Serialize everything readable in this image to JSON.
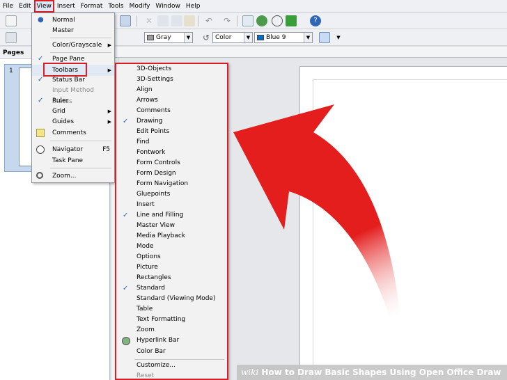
{
  "menubar": {
    "items": [
      "File",
      "Edit",
      "View",
      "Insert",
      "Format",
      "Tools",
      "Modify",
      "Window",
      "Help"
    ]
  },
  "toolbar2": {
    "area_style_value": "Gray",
    "line_style_value": "Color",
    "line_color_value": "Blue 9",
    "line_color_hex": "#0a6ac8"
  },
  "pages_pane": {
    "title": "Pages",
    "page_number": "1"
  },
  "view_menu": {
    "items": [
      {
        "label": "Normal",
        "mark": "radio"
      },
      {
        "label": "Master",
        "mark": ""
      },
      {
        "label": "Color/Grayscale",
        "mark": "",
        "submenu": true
      },
      {
        "label": "Page Pane",
        "mark": "check"
      },
      {
        "label": "Toolbars",
        "mark": "",
        "submenu": true
      },
      {
        "label": "Status Bar",
        "mark": "check"
      },
      {
        "label": "Input Method Status",
        "mark": "",
        "disabled": true
      },
      {
        "label": "Ruler",
        "mark": "check"
      },
      {
        "label": "Grid",
        "mark": "",
        "submenu": true
      },
      {
        "label": "Guides",
        "mark": "",
        "submenu": true
      },
      {
        "label": "Comments",
        "mark": "icon"
      },
      {
        "label": "Navigator",
        "mark": "icon",
        "shortcut": "F5"
      },
      {
        "label": "Task Pane",
        "mark": ""
      },
      {
        "label": "Zoom...",
        "mark": "icon"
      }
    ]
  },
  "toolbars_submenu": {
    "items": [
      {
        "label": "3D-Objects",
        "checked": false
      },
      {
        "label": "3D-Settings",
        "checked": false
      },
      {
        "label": "Align",
        "checked": false
      },
      {
        "label": "Arrows",
        "checked": false
      },
      {
        "label": "Comments",
        "checked": false
      },
      {
        "label": "Drawing",
        "checked": true
      },
      {
        "label": "Edit Points",
        "checked": false
      },
      {
        "label": "Find",
        "checked": false
      },
      {
        "label": "Fontwork",
        "checked": false
      },
      {
        "label": "Form Controls",
        "checked": false
      },
      {
        "label": "Form Design",
        "checked": false
      },
      {
        "label": "Form Navigation",
        "checked": false
      },
      {
        "label": "Gluepoints",
        "checked": false
      },
      {
        "label": "Insert",
        "checked": false
      },
      {
        "label": "Line and Filling",
        "checked": true
      },
      {
        "label": "Master View",
        "checked": false
      },
      {
        "label": "Media Playback",
        "checked": false
      },
      {
        "label": "Mode",
        "checked": false
      },
      {
        "label": "Options",
        "checked": false
      },
      {
        "label": "Picture",
        "checked": false
      },
      {
        "label": "Rectangles",
        "checked": false
      },
      {
        "label": "Standard",
        "checked": true
      },
      {
        "label": "Standard (Viewing Mode)",
        "checked": false
      },
      {
        "label": "Table",
        "checked": false
      },
      {
        "label": "Text Formatting",
        "checked": false
      },
      {
        "label": "Zoom",
        "checked": false
      },
      {
        "label": "Hyperlink Bar",
        "checked": false,
        "icon": true
      },
      {
        "label": "Color Bar",
        "checked": false
      },
      {
        "label": "Customize...",
        "checked": false
      },
      {
        "label": "Reset",
        "checked": false,
        "disabled": true
      }
    ]
  },
  "watermark": {
    "brand": "wiki",
    "title": "How to Draw Basic Shapes Using Open Office Draw"
  },
  "colors": {
    "highlight_red": "#d61f26",
    "check_blue": "#2f66b8"
  }
}
